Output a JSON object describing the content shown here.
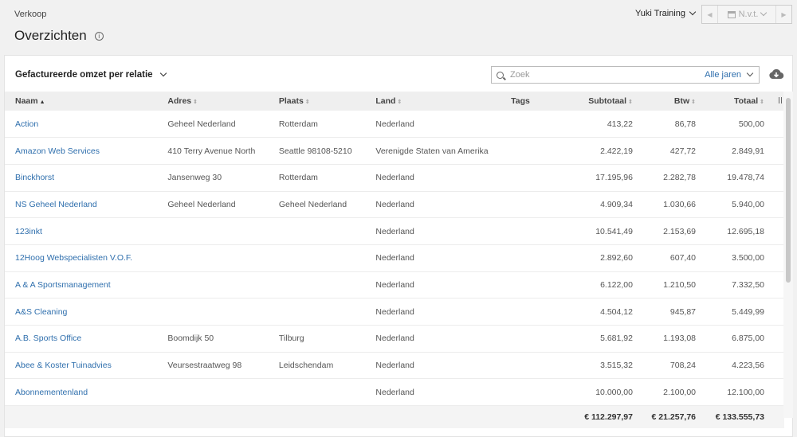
{
  "header": {
    "breadcrumb": "Verkoop",
    "title": "Overzichten",
    "company": "Yuki Training",
    "period": "N.v.t."
  },
  "toolbar": {
    "report": "Gefactureerde omzet per relatie",
    "search_placeholder": "Zoek",
    "years": "Alle jaren"
  },
  "columns": [
    "Naam",
    "Adres",
    "Plaats",
    "Land",
    "Tags",
    "Subtotaal",
    "Btw",
    "Totaal"
  ],
  "rows": [
    {
      "naam": "Action",
      "adres": "Geheel Nederland",
      "plaats": "Rotterdam",
      "land": "Nederland",
      "tags": "",
      "subtotaal": "413,22",
      "btw": "86,78",
      "totaal": "500,00"
    },
    {
      "naam": "Amazon Web Services",
      "adres": "410 Terry Avenue North",
      "plaats": "Seattle 98108-5210",
      "land": "Verenigde Staten van Amerika",
      "tags": "",
      "subtotaal": "2.422,19",
      "btw": "427,72",
      "totaal": "2.849,91"
    },
    {
      "naam": "Binckhorst",
      "adres": "Jansenweg 30",
      "plaats": "Rotterdam",
      "land": "Nederland",
      "tags": "",
      "subtotaal": "17.195,96",
      "btw": "2.282,78",
      "totaal": "19.478,74"
    },
    {
      "naam": "NS Geheel Nederland",
      "adres": "Geheel Nederland",
      "plaats": "Geheel Nederland",
      "land": "Nederland",
      "tags": "",
      "subtotaal": "4.909,34",
      "btw": "1.030,66",
      "totaal": "5.940,00"
    },
    {
      "naam": "123inkt",
      "adres": "",
      "plaats": "",
      "land": "Nederland",
      "tags": "",
      "subtotaal": "10.541,49",
      "btw": "2.153,69",
      "totaal": "12.695,18"
    },
    {
      "naam": "12Hoog Webspecialisten V.O.F.",
      "adres": "",
      "plaats": "",
      "land": "Nederland",
      "tags": "",
      "subtotaal": "2.892,60",
      "btw": "607,40",
      "totaal": "3.500,00"
    },
    {
      "naam": "A & A Sportsmanagement",
      "adres": "",
      "plaats": "",
      "land": "Nederland",
      "tags": "",
      "subtotaal": "6.122,00",
      "btw": "1.210,50",
      "totaal": "7.332,50"
    },
    {
      "naam": "A&S Cleaning",
      "adres": "",
      "plaats": "",
      "land": "Nederland",
      "tags": "",
      "subtotaal": "4.504,12",
      "btw": "945,87",
      "totaal": "5.449,99"
    },
    {
      "naam": "A.B. Sports Office",
      "adres": "Boomdijk 50",
      "plaats": "Tilburg",
      "land": "Nederland",
      "tags": "",
      "subtotaal": "5.681,92",
      "btw": "1.193,08",
      "totaal": "6.875,00"
    },
    {
      "naam": "Abee & Koster Tuinadvies",
      "adres": "Veursestraatweg 98",
      "plaats": "Leidschendam",
      "land": "Nederland",
      "tags": "",
      "subtotaal": "3.515,32",
      "btw": "708,24",
      "totaal": "4.223,56"
    },
    {
      "naam": "Abonnementenland",
      "adres": "",
      "plaats": "",
      "land": "Nederland",
      "tags": "",
      "subtotaal": "10.000,00",
      "btw": "2.100,00",
      "totaal": "12.100,00"
    }
  ],
  "totals": {
    "subtotaal": "€ 112.297,97",
    "btw": "€ 21.257,76",
    "totaal": "€ 133.555,73"
  }
}
